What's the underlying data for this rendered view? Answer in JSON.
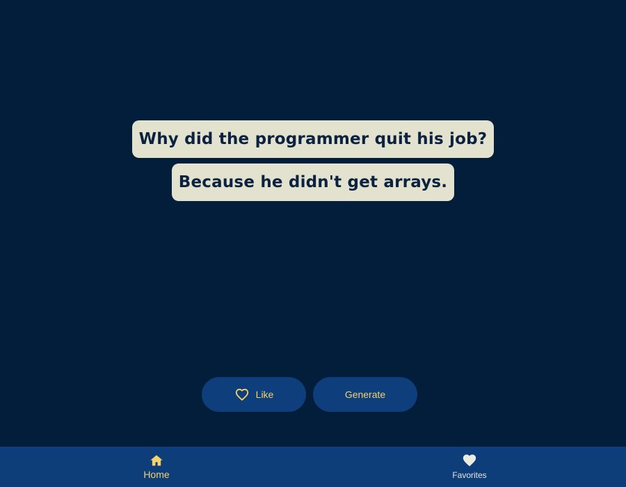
{
  "joke": {
    "setup": "Why did the programmer quit his job?",
    "punchline": "Because he didn't get arrays."
  },
  "actions": {
    "like_label": "Like",
    "generate_label": "Generate"
  },
  "bottom_nav": {
    "items": [
      {
        "label": "Home",
        "icon": "home-icon",
        "active": true
      },
      {
        "label": "Favorites",
        "icon": "heart-icon",
        "active": false
      }
    ]
  },
  "colors": {
    "background": "#031e3b",
    "bubble": "#e3e2cf",
    "bubble_text": "#0b2240",
    "button": "#0f3e7c",
    "accent": "#f3d36a",
    "nav_bar": "#0e3e7a"
  }
}
